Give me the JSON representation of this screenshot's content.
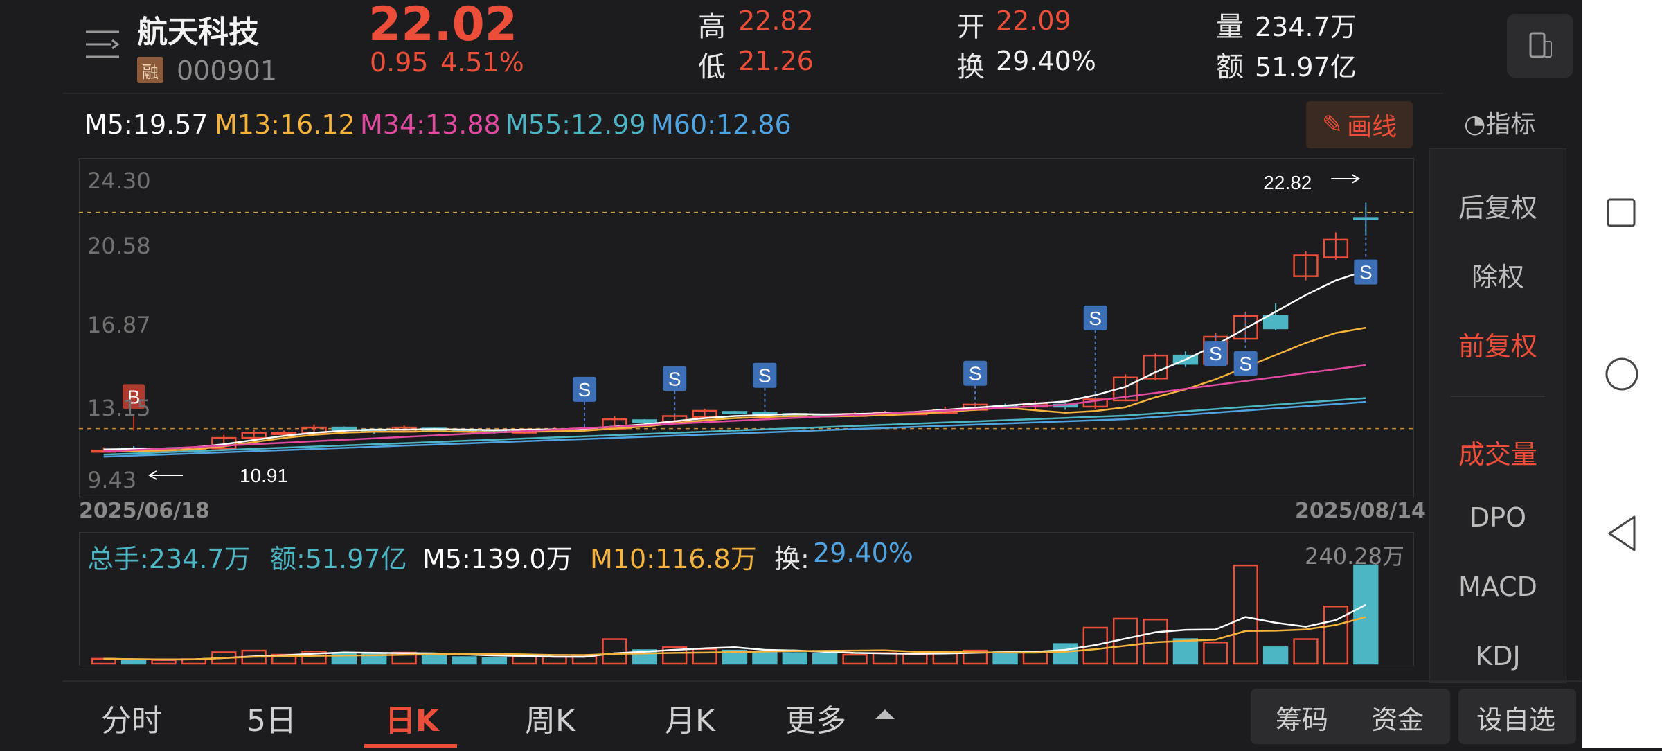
{
  "header": {
    "name": "航天科技",
    "rong_badge": "融",
    "code": "000901",
    "price": "22.02",
    "change": "0.95",
    "change_pct": "4.51%",
    "high_label": "高",
    "high": "22.82",
    "low_label": "低",
    "low": "21.26",
    "open_label": "开",
    "open": "22.09",
    "turnover_label": "换",
    "turnover": "29.40%",
    "vol_label": "量",
    "vol": "234.7万",
    "amount_label": "额",
    "amount": "51.97亿"
  },
  "ma": {
    "m5": "M5:19.57",
    "m13": "M13:16.12",
    "m34": "M34:13.88",
    "m55": "M55:12.99",
    "m60": "M60:12.86"
  },
  "draw_button": "画线",
  "indicator_label": "指标",
  "right_panel": [
    "后复权",
    "除权",
    "前复权",
    "成交量",
    "DPO",
    "MACD",
    "KDJ"
  ],
  "y_axis": [
    "24.30",
    "20.58",
    "16.87",
    "13.15",
    "9.43"
  ],
  "dates": {
    "start": "2025/06/18",
    "end": "2025/08/14"
  },
  "annotations": {
    "high": "22.82",
    "low": "10.91",
    "buy": "B",
    "sell": "S"
  },
  "volume": {
    "total": "总手:234.7万",
    "amount": "额:51.97亿",
    "m5": "M5:139.0万",
    "m10": "M10:116.8万",
    "turn_label": "换:",
    "turn_value": "29.40%",
    "max": "240.28万"
  },
  "tabs": [
    "分时",
    "5日",
    "日K",
    "周K",
    "月K",
    "更多"
  ],
  "pills": {
    "chip": "筹码",
    "fund": "资金",
    "fav": "设自选"
  },
  "colors": {
    "up": "#ec4e3a",
    "down": "#4db6c4",
    "ma5": "#ffffff",
    "ma13": "#f5b33c",
    "ma34": "#e14aa0",
    "ma55": "#4db6c4",
    "ma60": "#4fa3e0"
  },
  "chart_data": {
    "type": "candlestick",
    "x_range": [
      "2025/06/18",
      "2025/08/14"
    ],
    "ylim": [
      9.43,
      24.3
    ],
    "y_ticks": [
      24.3,
      20.58,
      16.87,
      13.15,
      9.43
    ],
    "candles": [
      [
        10.95,
        10.95,
        11.1,
        10.85
      ],
      [
        11.05,
        11.0,
        11.15,
        10.9
      ],
      [
        11.0,
        11.0,
        11.05,
        10.92
      ],
      [
        10.98,
        11.02,
        11.1,
        10.91
      ],
      [
        11.05,
        11.55,
        11.7,
        11.0
      ],
      [
        11.55,
        11.8,
        11.95,
        11.5
      ],
      [
        11.75,
        11.8,
        11.9,
        11.65
      ],
      [
        11.8,
        12.05,
        12.2,
        11.75
      ],
      [
        12.05,
        11.95,
        12.1,
        11.85
      ],
      [
        11.95,
        11.85,
        12.0,
        11.75
      ],
      [
        11.85,
        12.05,
        12.15,
        11.8
      ],
      [
        12.0,
        11.95,
        12.05,
        11.85
      ],
      [
        11.95,
        11.9,
        12.0,
        11.8
      ],
      [
        11.9,
        11.85,
        11.95,
        11.75
      ],
      [
        11.8,
        11.95,
        12.0,
        11.75
      ],
      [
        11.95,
        11.95,
        12.05,
        11.85
      ],
      [
        11.95,
        12.0,
        12.1,
        11.85
      ],
      [
        12.0,
        12.45,
        12.6,
        11.95
      ],
      [
        12.4,
        12.3,
        12.45,
        12.2
      ],
      [
        12.3,
        12.6,
        12.7,
        12.25
      ],
      [
        12.55,
        12.85,
        12.95,
        12.5
      ],
      [
        12.8,
        12.75,
        12.85,
        12.7
      ],
      [
        12.75,
        12.7,
        12.8,
        12.65
      ],
      [
        12.7,
        12.65,
        12.75,
        12.55
      ],
      [
        12.65,
        12.6,
        12.7,
        12.55
      ],
      [
        12.6,
        12.7,
        12.8,
        12.55
      ],
      [
        12.7,
        12.75,
        12.85,
        12.65
      ],
      [
        12.75,
        12.75,
        12.85,
        12.65
      ],
      [
        12.75,
        12.9,
        13.05,
        12.7
      ],
      [
        12.9,
        13.15,
        13.25,
        12.85
      ],
      [
        13.1,
        13.05,
        13.2,
        12.95
      ],
      [
        13.05,
        13.2,
        13.3,
        12.95
      ],
      [
        13.15,
        13.05,
        13.25,
        12.9
      ],
      [
        13.05,
        13.4,
        13.5,
        12.95
      ],
      [
        13.35,
        14.45,
        14.6,
        13.3
      ],
      [
        14.4,
        15.5,
        15.6,
        14.3
      ],
      [
        15.5,
        15.1,
        15.7,
        14.95
      ],
      [
        15.1,
        16.4,
        16.6,
        15.0
      ],
      [
        16.3,
        17.4,
        17.6,
        16.15
      ],
      [
        17.4,
        16.8,
        18.0,
        16.7
      ],
      [
        19.3,
        20.3,
        20.5,
        19.1
      ],
      [
        20.2,
        21.05,
        21.4,
        20.1
      ],
      [
        22.09,
        22.02,
        22.82,
        21.26
      ]
    ],
    "ma5": [
      11.0,
      11.02,
      11.05,
      11.1,
      11.25,
      11.45,
      11.65,
      11.8,
      11.9,
      11.95,
      11.95,
      11.97,
      11.95,
      11.93,
      11.95,
      11.96,
      12.0,
      12.1,
      12.2,
      12.35,
      12.5,
      12.6,
      12.65,
      12.7,
      12.68,
      12.7,
      12.74,
      12.8,
      12.9,
      13.0,
      13.1,
      13.2,
      13.3,
      13.6,
      14.0,
      14.7,
      15.3,
      16.0,
      16.8,
      17.6,
      18.4,
      19.1,
      19.57
    ],
    "volume": [
      12,
      10,
      9,
      11,
      28,
      32,
      22,
      30,
      26,
      24,
      27,
      20,
      16,
      14,
      18,
      17,
      19,
      60,
      33,
      40,
      36,
      32,
      28,
      26,
      24,
      22,
      26,
      24,
      29,
      32,
      30,
      30,
      48,
      88,
      110,
      108,
      60,
      52,
      240,
      40,
      60,
      140,
      240.28
    ],
    "vol_max": 240.28
  }
}
